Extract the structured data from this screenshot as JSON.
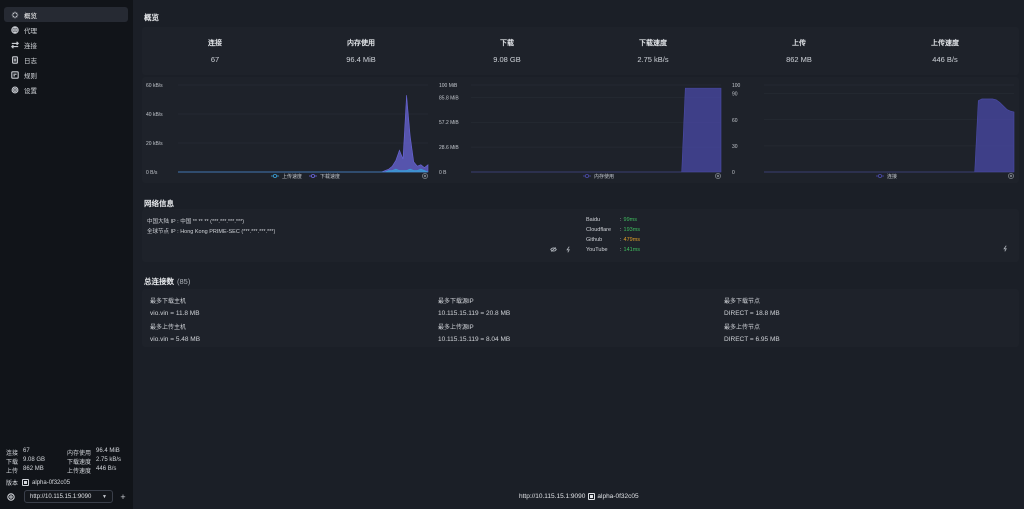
{
  "nav": [
    {
      "label": "概览",
      "icon": "sparkle-icon",
      "active": true
    },
    {
      "label": "代理",
      "icon": "globe-icon",
      "active": false
    },
    {
      "label": "连接",
      "icon": "swap-icon",
      "active": false
    },
    {
      "label": "日志",
      "icon": "document-icon",
      "active": false
    },
    {
      "label": "规则",
      "icon": "rules-icon",
      "active": false
    },
    {
      "label": "设置",
      "icon": "gear-icon",
      "active": false
    }
  ],
  "sidebar_stats": {
    "connections_label": "连接",
    "connections": "67",
    "memory_label": "内存使用",
    "memory": "96.4 MiB",
    "download_label": "下载",
    "download": "9.08 GB",
    "download_speed_label": "下载速度",
    "download_speed": "2.75 kB/s",
    "upload_label": "上传",
    "upload": "862 MB",
    "upload_speed_label": "上传速度",
    "upload_speed": "446 B/s",
    "version_label": "版本",
    "version": "alpha-0f32c05"
  },
  "backend": {
    "selected": "http://10.115.15.1:9090"
  },
  "overview": {
    "title": "概览",
    "metrics": [
      {
        "label": "连接",
        "value": "67"
      },
      {
        "label": "内存使用",
        "value": "96.4 MiB"
      },
      {
        "label": "下载",
        "value": "9.08 GB"
      },
      {
        "label": "下载速度",
        "value": "2.75 kB/s"
      },
      {
        "label": "上传",
        "value": "862 MB"
      },
      {
        "label": "上传速度",
        "value": "446 B/s"
      }
    ]
  },
  "chart_data": [
    {
      "type": "area",
      "yticks": [
        "60 kB/s",
        "40 kB/s",
        "20 kB/s",
        "0 B/s"
      ],
      "ylim": [
        0,
        60
      ],
      "legend": [
        "上传速度",
        "下载速度"
      ],
      "series": [
        {
          "name": "上传速度",
          "color": "#3aa0d8",
          "values": [
            0,
            0,
            0,
            0,
            0,
            0,
            0,
            0,
            0,
            0,
            0,
            0,
            0,
            0,
            0,
            0,
            0,
            0,
            0,
            0,
            0,
            0,
            0,
            0,
            0,
            0,
            0,
            0,
            0,
            0,
            0,
            0,
            0,
            0,
            0,
            0,
            0,
            0,
            0,
            0,
            0,
            0,
            0,
            0,
            0,
            0,
            0,
            0,
            0,
            0,
            0,
            0,
            0,
            0,
            0,
            0,
            0,
            0,
            0,
            1,
            1,
            2,
            1,
            1,
            1,
            2,
            1,
            1,
            2,
            1,
            0
          ]
        },
        {
          "name": "下载速度",
          "color": "#6a66d9",
          "values": [
            0,
            0,
            0,
            0,
            0,
            0,
            0,
            0,
            0,
            0,
            0,
            0,
            0,
            0,
            0,
            0,
            0,
            0,
            0,
            0,
            0,
            0,
            0,
            0,
            0,
            0,
            0,
            0,
            0,
            0,
            0,
            0,
            0,
            0,
            0,
            0,
            0,
            0,
            0,
            0,
            0,
            0,
            0,
            0,
            0,
            0,
            0,
            0,
            0,
            0,
            0,
            0,
            0,
            0,
            0,
            0,
            0,
            0,
            1,
            2,
            4,
            8,
            15,
            9,
            53,
            25,
            7,
            4,
            5,
            3,
            5
          ]
        }
      ]
    },
    {
      "type": "area",
      "yticks": [
        "100 MiB",
        "85.8 MiB",
        "57.2 MiB",
        "28.6 MiB",
        "0 B"
      ],
      "ylim": [
        0,
        100
      ],
      "legend": [
        "内存使用"
      ],
      "series": [
        {
          "name": "内存使用",
          "color": "#4a4aa8",
          "values": [
            0,
            0,
            0,
            0,
            0,
            0,
            0,
            0,
            0,
            0,
            0,
            0,
            0,
            0,
            0,
            0,
            0,
            0,
            0,
            0,
            0,
            0,
            0,
            0,
            0,
            0,
            0,
            0,
            0,
            0,
            0,
            0,
            0,
            0,
            0,
            0,
            0,
            0,
            0,
            0,
            0,
            0,
            0,
            0,
            0,
            0,
            0,
            0,
            0,
            0,
            0,
            0,
            0,
            0,
            0,
            0,
            0,
            0,
            0,
            0,
            96.4,
            96.4,
            96.4,
            96.4,
            96.4,
            96.4,
            96.4,
            96.4,
            96.4,
            96.4,
            96.4
          ]
        }
      ]
    },
    {
      "type": "area",
      "yticks": [
        "100",
        "90",
        "60",
        "30",
        "0"
      ],
      "ylim": [
        0,
        100
      ],
      "legend": [
        "连接"
      ],
      "series": [
        {
          "name": "连接",
          "color": "#4a4aa8",
          "values": [
            0,
            0,
            0,
            0,
            0,
            0,
            0,
            0,
            0,
            0,
            0,
            0,
            0,
            0,
            0,
            0,
            0,
            0,
            0,
            0,
            0,
            0,
            0,
            0,
            0,
            0,
            0,
            0,
            0,
            0,
            0,
            0,
            0,
            0,
            0,
            0,
            0,
            0,
            0,
            0,
            0,
            0,
            0,
            0,
            0,
            0,
            0,
            0,
            0,
            0,
            0,
            0,
            0,
            0,
            0,
            0,
            0,
            0,
            0,
            0,
            82,
            84,
            84,
            84,
            84,
            83,
            80,
            76,
            72,
            70,
            69
          ]
        }
      ]
    }
  ],
  "network": {
    "title": "网络信息",
    "mainland_ip": "中国大陆 IP : 中国 ** ** ** (***.***.***.***)",
    "global_ip": "全球节点 IP : Hong Kong PRIME-SEC (***.***.***.***)",
    "latency": [
      {
        "name": "Baidu",
        "value": "99ms",
        "color": "#3fbf5f"
      },
      {
        "name": "Cloudflare",
        "value": "193ms",
        "color": "#3fbf5f"
      },
      {
        "name": "Github",
        "value": "479ms",
        "color": "#e0a028"
      },
      {
        "name": "YouTube",
        "value": "141ms",
        "color": "#3fbf5f"
      }
    ]
  },
  "connections": {
    "title": "总连接数",
    "count": "(85)",
    "top": [
      {
        "label": "最多下载主机",
        "value": "vio.vin = 11.8 MB"
      },
      {
        "label": "最多下载源IP",
        "value": "10.115.15.119 = 20.8 MB"
      },
      {
        "label": "最多下载节点",
        "value": "DIRECT = 18.8 MB"
      },
      {
        "label": "最多上传主机",
        "value": "vio.vin = 5.48 MB"
      },
      {
        "label": "最多上传源IP",
        "value": "10.115.15.119 = 8.04 MB"
      },
      {
        "label": "最多上传节点",
        "value": "DIRECT = 6.95 MB"
      }
    ]
  },
  "footer": {
    "backend": "http://10.115.15.1:9090",
    "version": "alpha-0f32c05"
  }
}
